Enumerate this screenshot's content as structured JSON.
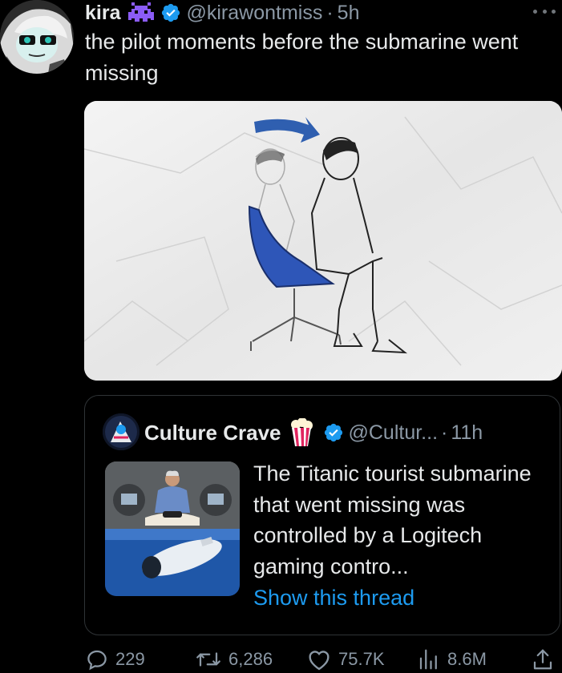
{
  "tweet": {
    "display_name": "kira",
    "name_emoji": "alien-monster-emoji",
    "verified": true,
    "handle": "@kirawontmiss",
    "separator": "·",
    "time": "5h",
    "text": "the pilot moments before the submarine went missing",
    "media": {
      "description_icon": "pilot-chair-sketch"
    }
  },
  "quote": {
    "display_name": "Culture Crave",
    "name_emoji": "popcorn-emoji",
    "verified": true,
    "handle": "@Cultur...",
    "separator": "·",
    "time": "11h",
    "text": "The Titanic tourist submarine that went missing was controlled by a Logitech gaming contro...",
    "show_thread": "Show this thread"
  },
  "actions": {
    "replies": "229",
    "retweets": "6,286",
    "likes": "75.7K",
    "views": "8.6M"
  },
  "colors": {
    "background": "#000000",
    "text": "#e7e9ea",
    "secondary": "#8b98a5",
    "link": "#1d9bf0",
    "verified": "#1d9bf0",
    "border": "#2f3336"
  }
}
